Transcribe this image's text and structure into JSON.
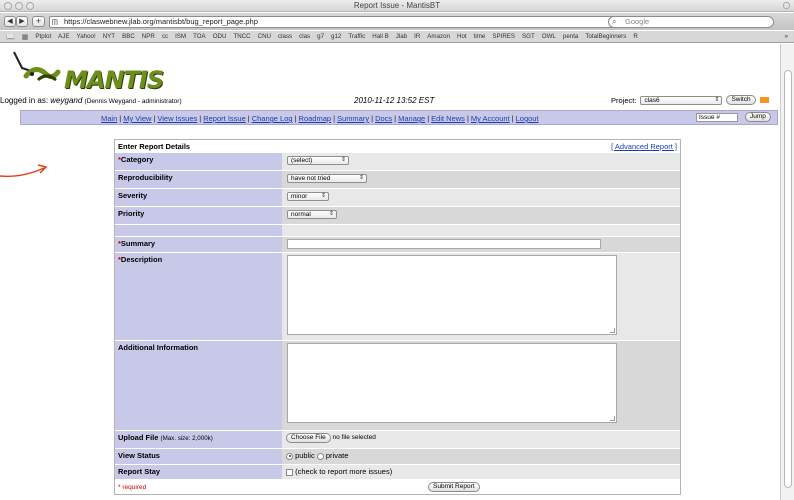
{
  "window": {
    "title": "Report Issue - MantisBT"
  },
  "browser": {
    "url": "https://claswebnew.jlab.org/mantisbt/bug_report_page.php",
    "search_placeholder": "Google",
    "bookmarks": [
      "Ptplot",
      "AJE",
      "Yahoo!",
      "NYT",
      "BBC",
      "NPR",
      "cc",
      "ISM",
      "TOA",
      "ODU",
      "TNCC",
      "CNU",
      "class",
      "clas",
      "g7",
      "g12",
      "Traffic",
      "Hall B",
      "Jlab",
      "IR",
      "Amazon",
      "Hot",
      "time",
      "SPIRES",
      "SGT",
      "OWL",
      "penta",
      "TotalBeginners",
      "R"
    ]
  },
  "header": {
    "logo_text": "MANTIS",
    "logged_in_prefix": "Logged in as:",
    "username": "weygand",
    "user_detail": "(Dennis Weygand - administrator)",
    "datetime": "2010-11-12 13:52 EST",
    "project_label": "Project:",
    "project_value": "clas6",
    "switch_label": "Switch"
  },
  "menu": {
    "items": [
      "Main",
      "My View",
      "View Issues",
      "Report Issue",
      "Change Log",
      "Roadmap",
      "Summary",
      "Docs",
      "Manage",
      "Edit News",
      "My Account",
      "Logout"
    ],
    "issue_placeholder": "Issue #",
    "jump_label": "Jump"
  },
  "form": {
    "title": "Enter Report Details",
    "advanced_link": "[ Advanced Report ]",
    "category_label": "Category",
    "category_value": "(select)",
    "reproducibility_label": "Reproducibility",
    "reproducibility_value": "have not tried",
    "severity_label": "Severity",
    "severity_value": "minor",
    "priority_label": "Priority",
    "priority_value": "normal",
    "summary_label": "Summary",
    "description_label": "Description",
    "additional_label": "Additional Information",
    "upload_label": "Upload File",
    "upload_note": "(Max. size: 2,000k)",
    "choose_file_label": "Choose File",
    "no_file_text": "no file selected",
    "view_status_label": "View Status",
    "public_label": "public",
    "private_label": "private",
    "report_stay_label": "Report Stay",
    "report_stay_text": "(check to report more issues)",
    "required_note": "* required",
    "submit_label": "Submit Report"
  }
}
